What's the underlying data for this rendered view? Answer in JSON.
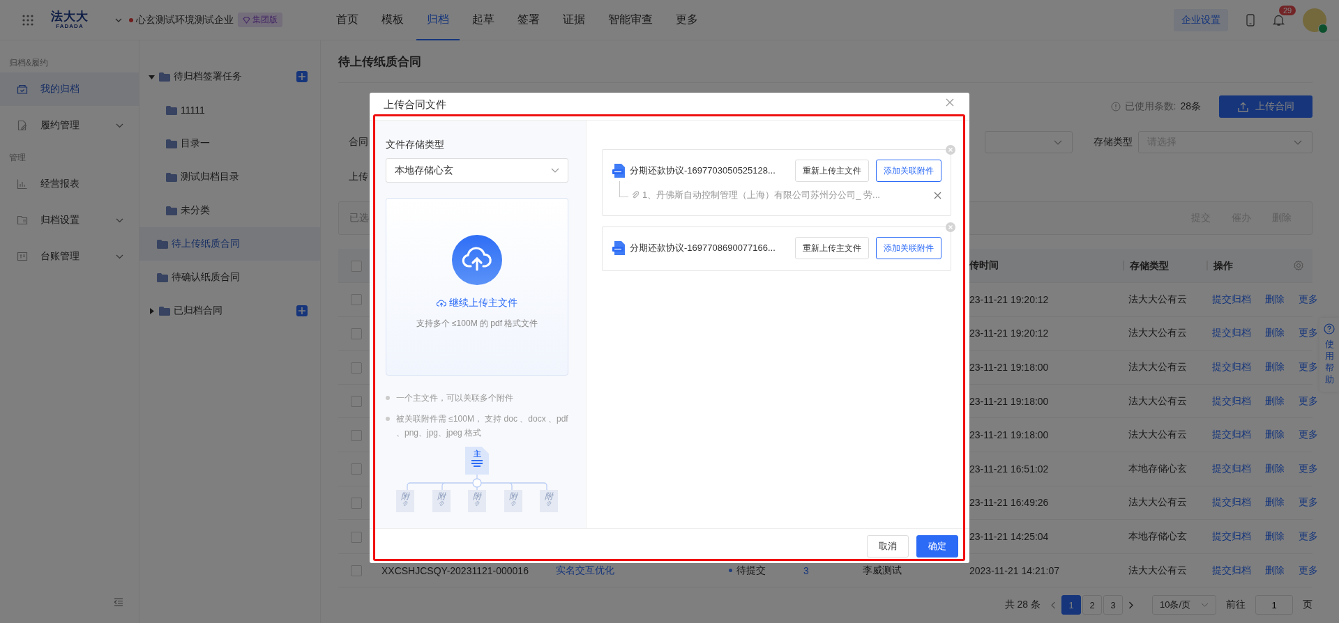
{
  "header": {
    "logo_cn": "法大大",
    "logo_en": "FADADA",
    "company": "心玄测试环境测试企业",
    "edition": "集团版",
    "settings_button": "企业设置",
    "notification_count": "29",
    "nav": [
      {
        "label": "首页",
        "selected": false
      },
      {
        "label": "模板",
        "selected": false
      },
      {
        "label": "归档",
        "selected": true
      },
      {
        "label": "起草",
        "selected": false
      },
      {
        "label": "签署",
        "selected": false
      },
      {
        "label": "证据",
        "selected": false
      },
      {
        "label": "智能审查",
        "selected": false
      },
      {
        "label": "更多",
        "selected": false
      }
    ]
  },
  "sidebar": {
    "sections": [
      {
        "title": "归档&履约",
        "items": [
          {
            "label": "我的归档",
            "selected": true,
            "has_submenu": false
          },
          {
            "label": "履约管理",
            "selected": false,
            "has_submenu": true
          }
        ]
      },
      {
        "title": "管理",
        "items": [
          {
            "label": "经营报表",
            "selected": false,
            "has_submenu": false
          },
          {
            "label": "归档设置",
            "selected": false,
            "has_submenu": true
          },
          {
            "label": "台账管理",
            "selected": false,
            "has_submenu": true
          }
        ]
      }
    ]
  },
  "folder_tree": [
    {
      "kind": "group",
      "label": "待归档签署任务",
      "expanded": true,
      "selected": false,
      "children": [
        {
          "label": "11111",
          "selected": false
        },
        {
          "label": "目录一",
          "selected": false
        },
        {
          "label": "测试归档目录",
          "selected": false
        },
        {
          "label": "未分类",
          "selected": false
        }
      ]
    },
    {
      "kind": "folder",
      "label": "待上传纸质合同",
      "selected": true
    },
    {
      "kind": "folder",
      "label": "待确认纸质合同",
      "selected": false
    },
    {
      "kind": "group",
      "label": "已归档合同",
      "expanded": false,
      "selected": false
    }
  ],
  "page": {
    "title": "待上传纸质合同",
    "usage_label": "已使用条数:",
    "usage_value": "28条",
    "upload_button": "上传合同",
    "filter_label_1": "合同",
    "storage_label": "存储类型",
    "storage_placeholder": "请选择",
    "filter_label_2": "上传",
    "selection_label": "已选",
    "bulk_actions": [
      {
        "label": "提交",
        "disabled": true
      },
      {
        "label": "催办",
        "disabled": true
      },
      {
        "label": "删除",
        "disabled": true
      }
    ]
  },
  "table": {
    "columns": [
      "传时间",
      "存储类型",
      "操作"
    ],
    "all_checked": false,
    "rows": [
      {
        "checked": false,
        "upload_time": "23-11-21 19:20:12",
        "storage": "法大大公有云",
        "actions": [
          "提交归档",
          "删除",
          "更多"
        ]
      },
      {
        "checked": false,
        "upload_time": "23-11-21 19:20:12",
        "storage": "法大大公有云",
        "actions": [
          "提交归档",
          "删除",
          "更多"
        ]
      },
      {
        "checked": false,
        "upload_time": "23-11-21 19:18:00",
        "storage": "法大大公有云",
        "actions": [
          "提交归档",
          "删除",
          "更多"
        ]
      },
      {
        "checked": false,
        "upload_time": "23-11-21 19:18:00",
        "storage": "法大大公有云",
        "actions": [
          "提交归档",
          "删除",
          "更多"
        ]
      },
      {
        "checked": false,
        "upload_time": "23-11-21 19:18:00",
        "storage": "法大大公有云",
        "actions": [
          "提交归档",
          "删除",
          "更多"
        ]
      },
      {
        "checked": false,
        "upload_time": "23-11-21 16:51:02",
        "storage": "本地存储心玄",
        "actions": [
          "提交归档",
          "删除",
          "更多"
        ]
      },
      {
        "checked": false,
        "upload_time": "23-11-21 16:49:26",
        "storage": "法大大公有云",
        "actions": [
          "提交归档",
          "删除",
          "更多"
        ]
      },
      {
        "checked": false,
        "upload_time": "23-11-21 14:25:04",
        "storage": "本地存储心玄",
        "actions": [
          "提交归档",
          "删除",
          "更多"
        ]
      },
      {
        "checked": false,
        "number": "XXCSHJCSQY-20231121-000016",
        "name": "实名交互优化",
        "status": {
          "label": "待提交",
          "color": "#203e7b"
        },
        "count": "3",
        "creator": "李威测试",
        "upload_time": "2023-11-21 14:21:07",
        "storage": "法大大公有云",
        "actions": [
          "提交归档",
          "删除",
          "更多"
        ]
      }
    ]
  },
  "pagination": {
    "total": "共 28 条",
    "pages": [
      {
        "label": "1",
        "selected": true
      },
      {
        "label": "2",
        "selected": false
      },
      {
        "label": "3",
        "selected": false
      }
    ],
    "page_size": "10条/页",
    "goto_label": "前往",
    "goto_value": "1",
    "goto_suffix": "页"
  },
  "help_tab": "使用帮助",
  "modal": {
    "title": "上传合同文件",
    "storage_label": "文件存储类型",
    "storage_value": "本地存储心玄",
    "upload_link": "继续上传主文件",
    "upload_hint": "支持多个 ≤100M 的 pdf 格式文件",
    "notes": [
      "一个主文件，可以关联多个附件",
      "被关联附件需 ≤100M， 支持 doc 、docx 、pdf 、png、jpg、jpeg 格式"
    ],
    "diagram": {
      "main_label": "主",
      "attachment_labels": [
        "附",
        "附",
        "附",
        "附",
        "附"
      ]
    },
    "files": [
      {
        "name": "分期还款协议-1697703050525128...",
        "reupload_button": "重新上传主文件",
        "attach_button": "添加关联附件",
        "attachments": [
          "1、丹佛斯自动控制管理（上海）有限公司苏州分公司_ 劳..."
        ]
      },
      {
        "name": "分期还款协议-1697708690077166...",
        "reupload_button": "重新上传主文件",
        "attach_button": "添加关联附件"
      }
    ],
    "cancel_button": "取消",
    "confirm_button": "确定"
  }
}
